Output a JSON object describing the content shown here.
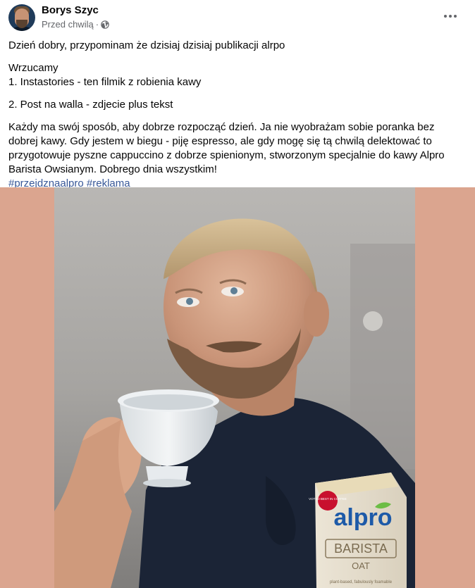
{
  "author": {
    "name": "Borys Szyc",
    "timestamp": "Przed chwilą",
    "audience_icon": "globe-icon"
  },
  "actions": {
    "more_icon": "more-horizontal-icon"
  },
  "post": {
    "line1": "Dzień dobry, przypominam że dzisiaj dzisiaj publikacji alrpo",
    "line2": "Wrzucamy",
    "line3": "1. Instastories - ten filmik z robienia kawy",
    "line4": "2. Post na walla - zdjecie plus tekst",
    "paragraph": "Każdy ma swój sposób, aby dobrze rozpocząć dzień. Ja nie wyobrażam sobie poranka bez dobrej kawy. Gdy jestem w biegu - piję espresso, ale gdy mogę się tą chwilą delektować to przygotowuje pyszne cappuccino z dobrze spienionym, stworzonym specjalnie do kawy Alpro Barista Owsianym. Dobrego dnia wszystkim!",
    "hashtags": [
      "#przejdznaalpro",
      "#reklama"
    ]
  },
  "photo": {
    "carton_brand": "alpro",
    "carton_product": "BARISTA",
    "carton_variant": "OAT",
    "carton_badge": "VOTED BEST IN COFFEE",
    "carton_tagline": "plant-based, fabulously foamable"
  },
  "colors": {
    "link": "#385898",
    "media_background": "#dba58f",
    "secondary_text": "#65676b"
  }
}
